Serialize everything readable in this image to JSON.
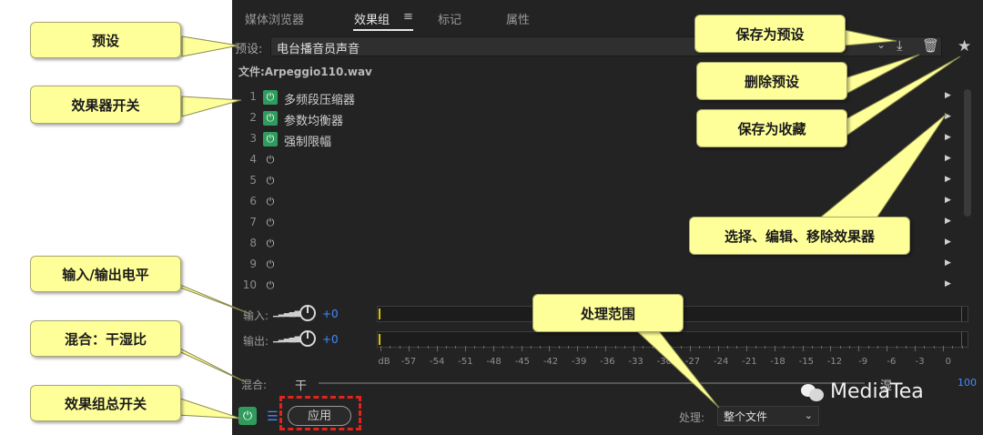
{
  "tabs": [
    {
      "label": "媒体浏览器",
      "active": false
    },
    {
      "label": "效果组",
      "active": true
    },
    {
      "label": "标记",
      "active": false
    },
    {
      "label": "属性",
      "active": false
    }
  ],
  "tab_menu_icon": "hamburger-menu-icon",
  "preset": {
    "label": "预设:",
    "value": "电台播音员声音",
    "icons": [
      "download-save-icon",
      "trash-icon",
      "star-icon"
    ]
  },
  "file": {
    "label": "文件:Arpeggio110.wav"
  },
  "rack": [
    {
      "num": "1",
      "power": "on",
      "name": "多频段压缩器"
    },
    {
      "num": "2",
      "power": "on",
      "name": "参数均衡器"
    },
    {
      "num": "3",
      "power": "on",
      "name": "强制限幅"
    },
    {
      "num": "4",
      "power": "off",
      "name": ""
    },
    {
      "num": "5",
      "power": "off",
      "name": ""
    },
    {
      "num": "6",
      "power": "off",
      "name": ""
    },
    {
      "num": "7",
      "power": "off",
      "name": ""
    },
    {
      "num": "8",
      "power": "off",
      "name": ""
    },
    {
      "num": "9",
      "power": "off",
      "name": ""
    },
    {
      "num": "10",
      "power": "off",
      "name": ""
    }
  ],
  "input": {
    "label": "输入:",
    "value": "+0"
  },
  "output": {
    "label": "输出:",
    "value": "+0"
  },
  "db_scale": {
    "unit": "dB",
    "labels": [
      "-57",
      "-54",
      "-51",
      "-48",
      "-45",
      "-42",
      "-39",
      "-36",
      "-33",
      "-30",
      "-27",
      "-24",
      "-21",
      "-18",
      "-15",
      "-12",
      "-9",
      "-6",
      "-3",
      "0"
    ]
  },
  "mix": {
    "label": "混合:",
    "dry": "干",
    "wet": "湿",
    "percent": "100",
    "unit": "%"
  },
  "apply": {
    "label": "应用"
  },
  "process": {
    "label": "处理:",
    "value": "整个文件"
  },
  "watermark": {
    "text": "MediaTea"
  },
  "callouts": {
    "preset": "预设",
    "save_preset": "保存为预设",
    "delete_preset": "删除预设",
    "effect_switch": "效果器开关",
    "save_favorite": "保存为收藏",
    "select_edit": "选择、编辑、移除效果器",
    "io_level": "输入/输出电平",
    "mix_ratio": "混合：干湿比",
    "process_range": "处理范围",
    "master_switch": "效果组总开关"
  },
  "colors": {
    "panel_bg": "#232323",
    "power_on": "#2f9c5e",
    "accent_blue": "#3d8cff",
    "callout_bg": "#ffff99",
    "highlight_red": "#e0231c"
  }
}
